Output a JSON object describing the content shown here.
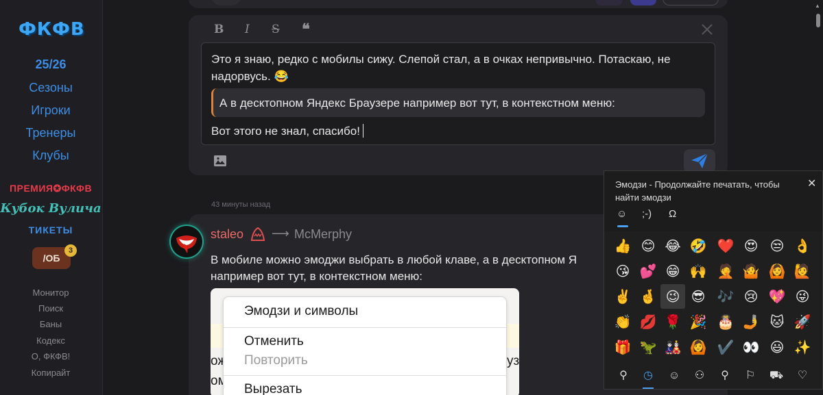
{
  "sidebar": {
    "logo": "ФКФВ",
    "season": "25/26",
    "nav": [
      "Сезоны",
      "Игроки",
      "Тренеры",
      "Клубы"
    ],
    "promo_premium": "ПРЕМИЯ✪ФКФВ",
    "promo_cup": "Кубок Вулича",
    "promo_tickets": "ТИКЕТЫ",
    "ob_label": "/ОБ",
    "ob_badge": "3",
    "secondary": [
      "Монитор",
      "Поиск",
      "Баны",
      "Кодекс",
      "О, ФКФВ!",
      "Копирайт"
    ]
  },
  "composer": {
    "format_bold": "B",
    "format_italic": "I",
    "format_strike": "S",
    "format_quote": "❝",
    "text_line1": "Это я знаю, редко с мобилы сижу. Слепой стал, а в очках непривычно. Потаскаю, не надорвусь. 😂",
    "quote": "А в десктопном Яндекс Браузере например вот тут, в контекстном меню:",
    "text_line2": "Вот этого не знал, спасибо!"
  },
  "feed": {
    "timestamp": "43 минуты назад",
    "author": "staleo",
    "arrow": "⟶",
    "recipient": "McMerphy",
    "message_line1": "В мобиле можно эмоджи выбрать в любой клаве, а в десктопном Я",
    "message_line2": "например вот тут, в контекстном меню:",
    "screenshot": {
      "menu_items": [
        "Эмодзи и символы",
        "Отменить",
        "Повторить",
        "Вырезать"
      ],
      "under_left": "ож",
      "under_left2": "ом",
      "under_right": "узе"
    }
  },
  "emoji_panel": {
    "title": "Эмодзи - Продолжайте печатать, чтобы найти эмодзи",
    "close": "✕",
    "tabs": [
      "☺",
      ";-)",
      "Ω"
    ],
    "grid": [
      [
        "👍",
        "😊",
        "😂",
        "🤣",
        "❤️",
        "😍",
        "😒",
        "👌"
      ],
      [
        "😘",
        "💕",
        "😁",
        "🙌",
        "🤦",
        "🤷",
        "🙆",
        "🙋"
      ],
      [
        "✌️",
        "🤞",
        "😉",
        "😎",
        "🎶",
        "😢",
        "💖",
        "😜"
      ],
      [
        "👏",
        "💋",
        "🌹",
        "🎉",
        "🎂",
        "🤳",
        "🐱",
        "🚀"
      ],
      [
        "🎁",
        "🦖",
        "🎎",
        "🙆",
        "✔️",
        "👀",
        "😃",
        "✨"
      ]
    ],
    "footer": [
      "⚲",
      "◷",
      "☺",
      "⚇",
      "⚲",
      "⚐",
      "⛟",
      "♡"
    ]
  },
  "colors": {
    "accent_blue": "#3d8ee6",
    "author_red": "#e86a6a",
    "quote_border": "#e0833a",
    "emoji_accent": "#4ba0f0"
  }
}
